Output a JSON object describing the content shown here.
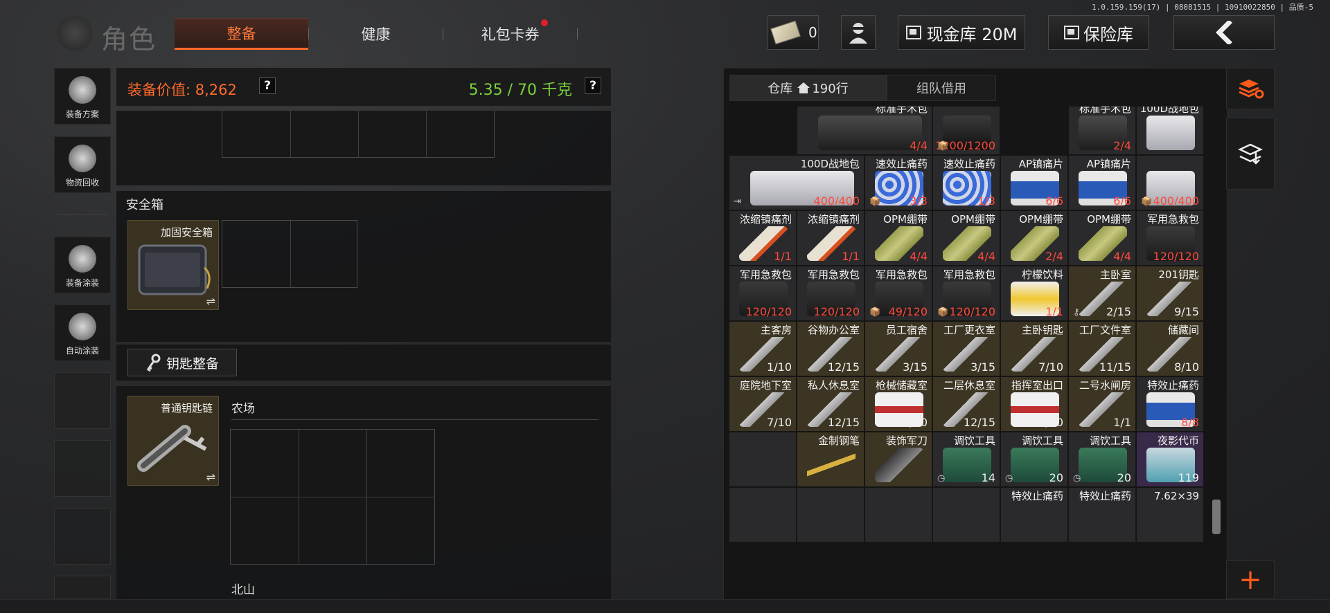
{
  "version": "1.0.159.159(17) | 08081515 | 10910022850 | 品质-5",
  "header": {
    "title": "角色",
    "tabs": [
      {
        "label": "整备",
        "active": true
      },
      {
        "label": "健康",
        "active": false
      },
      {
        "label": "礼包卡券",
        "active": false,
        "has_dot": true
      }
    ],
    "money_count": "0",
    "cash_label": "现金库 20M",
    "safe_label": "保险库",
    "back_icon": "chevron-left-icon"
  },
  "sidebar": {
    "items": [
      {
        "label": "装备方案",
        "icon": "helmet-icon"
      },
      {
        "label": "物资回收",
        "icon": "recycle-icon"
      },
      {
        "label": "装备涂装",
        "icon": "paint-helmet-icon"
      },
      {
        "label": "自动涂装",
        "icon": "brush-gear-icon"
      }
    ]
  },
  "loadout": {
    "value_label": "装备价值: 8,262",
    "weight_label": "5.35 / 70 千克",
    "help": "?",
    "safebox_section": "安全箱",
    "safebox_item": "加固安全箱",
    "key_button": "钥匙整备",
    "keychain_item": "普通钥匙链",
    "region_farm": "农场",
    "region_north": "北山",
    "swap_icon": "⇌"
  },
  "warehouse": {
    "tab_storage": "仓库",
    "rows": "190行",
    "tab_team": "组队借用",
    "colors": {
      "gold": "#3c3523",
      "gray": "#2a2a2c",
      "purple": "#3a2a4a",
      "red_count": "#ff4a3a"
    },
    "rows_data": [
      [
        {
          "name": "",
          "count": "",
          "type": "gray"
        },
        {
          "name": "标准手术包",
          "count": "4/4",
          "type": "gray",
          "red": true,
          "icon": "medical-bag-icon"
        },
        {
          "name": "",
          "count": "1200/1200",
          "type": "gray",
          "red": true,
          "icon": "case-icon",
          "mark": "📦"
        },
        {
          "name": "",
          "count": "",
          "type": "gray"
        },
        {
          "name": "标准手术包",
          "count": "2/4",
          "type": "gray",
          "red": true,
          "icon": "medical-bag-icon"
        },
        {
          "name": "100D战地包",
          "count": "",
          "type": "gray",
          "icon": "field-bag-icon"
        }
      ],
      [
        {
          "name": "100D战地包",
          "count": "400/400",
          "type": "gray",
          "red": true,
          "icon": "field-bag-icon",
          "mark": "⇥",
          "wide": true
        },
        {
          "name": "速效止痛药",
          "count": "3/3",
          "type": "gray",
          "red": true,
          "icon": "pills-icon",
          "mark": "📦"
        },
        {
          "name": "速效止痛药",
          "count": "1/3",
          "type": "gray",
          "red": true,
          "icon": "pills-icon"
        },
        {
          "name": "AP镇痛片",
          "count": "6/6",
          "type": "gray",
          "red": true,
          "icon": "bottle-icon"
        },
        {
          "name": "AP镇痛片",
          "count": "6/6",
          "type": "gray",
          "red": true,
          "icon": "bottle-icon"
        },
        {
          "name": "",
          "count": "400/400",
          "type": "gray",
          "red": true,
          "icon": "field-bag-icon",
          "mark": "📦"
        }
      ],
      [
        {
          "name": "浓缩镇痛剂",
          "count": "1/1",
          "type": "gray",
          "red": true,
          "icon": "syringe-icon"
        },
        {
          "name": "浓缩镇痛剂",
          "count": "1/1",
          "type": "gray",
          "red": true,
          "icon": "syringe-icon"
        },
        {
          "name": "OPM绷带",
          "count": "4/4",
          "type": "gray",
          "red": true,
          "icon": "bandage-icon"
        },
        {
          "name": "OPM绷带",
          "count": "4/4",
          "type": "gray",
          "red": true,
          "icon": "bandage-icon"
        },
        {
          "name": "OPM绷带",
          "count": "2/4",
          "type": "gray",
          "red": true,
          "icon": "bandage-icon"
        },
        {
          "name": "OPM绷带",
          "count": "4/4",
          "type": "gray",
          "red": true,
          "icon": "bandage-icon"
        },
        {
          "name": "军用急救包",
          "count": "120/120",
          "type": "gray",
          "red": true,
          "icon": "medkit-icon"
        }
      ],
      [
        {
          "name": "军用急救包",
          "count": "120/120",
          "type": "gray",
          "red": true,
          "icon": "medkit-icon"
        },
        {
          "name": "军用急救包",
          "count": "120/120",
          "type": "gray",
          "red": true,
          "icon": "medkit-icon"
        },
        {
          "name": "军用急救包",
          "count": "49/120",
          "type": "gray",
          "red": true,
          "icon": "medkit-icon",
          "mark": "📦"
        },
        {
          "name": "军用急救包",
          "count": "120/120",
          "type": "gray",
          "red": true,
          "icon": "medkit-icon",
          "mark": "📦"
        },
        {
          "name": "柠檬饮料",
          "count": "1/1",
          "type": "gray",
          "red": true,
          "icon": "drink-can-icon"
        },
        {
          "name": "主卧室",
          "count": "2/15",
          "type": "gold",
          "icon": "key-icon",
          "mark": "⚷"
        },
        {
          "name": "201钥匙",
          "count": "9/15",
          "type": "gold",
          "icon": "key-icon"
        }
      ],
      [
        {
          "name": "主客房",
          "count": "1/10",
          "type": "gold",
          "icon": "key-icon"
        },
        {
          "name": "谷物办公室",
          "count": "12/15",
          "type": "gold",
          "icon": "key-icon"
        },
        {
          "name": "员工宿舍",
          "count": "3/15",
          "type": "gold",
          "icon": "key-icon"
        },
        {
          "name": "工厂更衣室",
          "count": "3/15",
          "type": "gold",
          "icon": "key-icon"
        },
        {
          "name": "主卧钥匙",
          "count": "7/10",
          "type": "gold",
          "icon": "key-icon"
        },
        {
          "name": "工厂文件室",
          "count": "11/15",
          "type": "gold",
          "icon": "key-icon"
        },
        {
          "name": "储藏间",
          "count": "8/10",
          "type": "gold",
          "icon": "key-icon"
        }
      ],
      [
        {
          "name": "庭院地下室",
          "count": "7/10",
          "type": "gold",
          "icon": "key-icon"
        },
        {
          "name": "私人休息室",
          "count": "12/15",
          "type": "gold",
          "icon": "key-icon"
        },
        {
          "name": "枪械储藏室",
          "count": "10/10",
          "type": "gold",
          "icon": "keycard-icon"
        },
        {
          "name": "二层休息室",
          "count": "12/15",
          "type": "gold",
          "icon": "key-icon"
        },
        {
          "name": "指挥室出口",
          "count": "5/10",
          "type": "gold",
          "icon": "keycard-icon"
        },
        {
          "name": "二号水闸房",
          "count": "1/1",
          "type": "gold",
          "icon": "key-icon"
        },
        {
          "name": "特效止痛药",
          "count": "8/8",
          "type": "gray",
          "red": true,
          "icon": "bottle-icon"
        }
      ],
      [
        {
          "name": "",
          "count": "",
          "type": "gray"
        },
        {
          "name": "金制钢笔",
          "count": "",
          "type": "gold",
          "icon": "pen-icon"
        },
        {
          "name": "装饰军刀",
          "count": "",
          "type": "gold",
          "icon": "knife-icon"
        },
        {
          "name": "调饮工具",
          "count": "14",
          "type": "gray",
          "icon": "kettle-icon",
          "mark": "◷"
        },
        {
          "name": "调饮工具",
          "count": "20",
          "type": "gray",
          "icon": "kettle-icon",
          "mark": "◷"
        },
        {
          "name": "调饮工具",
          "count": "20",
          "type": "gray",
          "icon": "kettle-icon",
          "mark": "◷"
        },
        {
          "name": "夜影代币",
          "count": "119",
          "type": "purple",
          "icon": "token-icon"
        }
      ],
      [
        {
          "name": "",
          "count": "",
          "type": "gray"
        },
        {
          "name": "",
          "count": "",
          "type": "gray"
        },
        {
          "name": "",
          "count": "",
          "type": "gray"
        },
        {
          "name": "",
          "count": "",
          "type": "gray"
        },
        {
          "name": "特效止痛药",
          "count": "",
          "type": "gray"
        },
        {
          "name": "特效止痛药",
          "count": "",
          "type": "gray"
        },
        {
          "name": "7.62×39",
          "count": "",
          "type": "gray"
        }
      ]
    ]
  },
  "right_rail": {
    "sort_icon": "layers-refresh-icon",
    "stack_icon": "layers-down-icon",
    "plus": "+"
  }
}
